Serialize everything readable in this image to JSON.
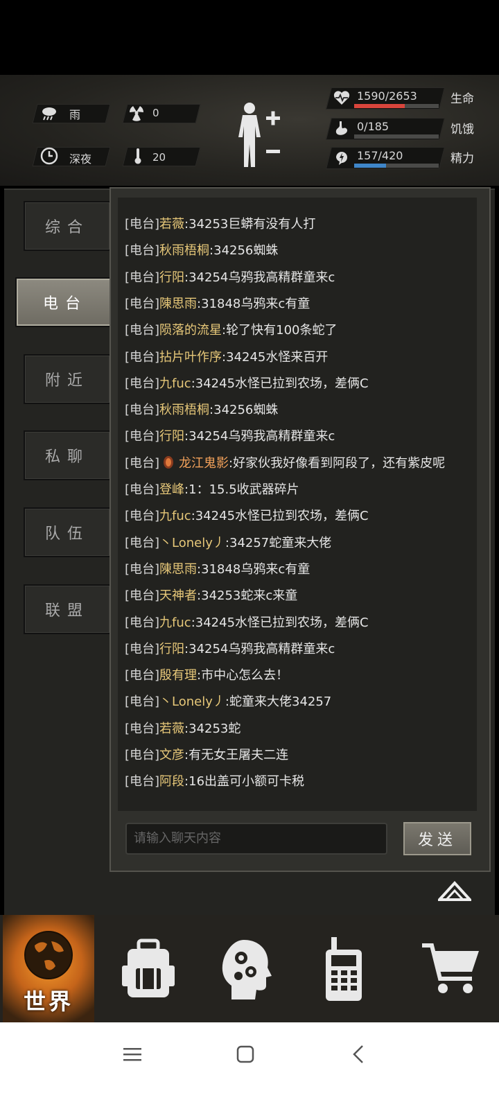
{
  "status": {
    "weather": {
      "icon": "rain-cloud-icon",
      "label": "雨"
    },
    "radiation": {
      "icon": "radiation-icon",
      "value": "0"
    },
    "time": {
      "icon": "clock-icon",
      "label": "深夜"
    },
    "temperature": {
      "icon": "thermometer-icon",
      "value": "20"
    },
    "body": {
      "icon": "body-figure-icon"
    },
    "health": {
      "value": "1590/2653",
      "label": "生命",
      "fraction": 0.599,
      "color": "#d9453c"
    },
    "hunger": {
      "value": "0/185",
      "label": "饥饿",
      "fraction": 0.0,
      "color": "#c9a24a"
    },
    "energy": {
      "value": "157/420",
      "label": "精力",
      "fraction": 0.374,
      "color": "#3f86c9"
    }
  },
  "tabs": [
    {
      "label": "综合",
      "active": false
    },
    {
      "label": "电台",
      "active": true
    },
    {
      "label": "附近",
      "active": false
    },
    {
      "label": "私聊",
      "active": false
    },
    {
      "label": "队伍",
      "active": false
    },
    {
      "label": "联盟",
      "active": false
    }
  ],
  "chat": {
    "messages": [
      {
        "tag": "[电台]",
        "name": "若薇",
        "text": ":34253巨蟒有没有人打"
      },
      {
        "tag": "[电台]",
        "name": "秋雨梧桐",
        "text": ":34256蜘蛛"
      },
      {
        "tag": "[电台]",
        "name": "行阳",
        "text": ":34254乌鸦我高精群童来c"
      },
      {
        "tag": "[电台]",
        "name": "陳思雨",
        "text": ":31848乌鸦来c有童"
      },
      {
        "tag": "[电台]",
        "name": "陨落的流星",
        "text": ":轮了快有100条蛇了"
      },
      {
        "tag": "[电台]",
        "name": "拈片叶作序",
        "text": ":34245水怪来百开"
      },
      {
        "tag": "[电台]",
        "name": "九fuc",
        "text": ":34245水怪已拉到农场，差俩C"
      },
      {
        "tag": "[电台]",
        "name": "秋雨梧桐",
        "text": ":34256蜘蛛"
      },
      {
        "tag": "[电台]",
        "name": "行阳",
        "text": ":34254乌鸦我高精群童来c"
      },
      {
        "tag": "[电台]",
        "name": "龙江鬼影",
        "text": ":好家伙我好像看到阿段了，还有紫皮呢",
        "badge": true
      },
      {
        "tag": "[电台]",
        "name": "登峰",
        "text": ":1：15.5收武器碎片"
      },
      {
        "tag": "[电台]",
        "name": "九fuc",
        "text": ":34245水怪已拉到农场，差俩C"
      },
      {
        "tag": "[电台]",
        "name": "丶Lonely丿",
        "text": ":34257蛇童来大佬"
      },
      {
        "tag": "[电台]",
        "name": "陳思雨",
        "text": ":31848乌鸦来c有童"
      },
      {
        "tag": "[电台]",
        "name": "天神者",
        "text": ":34253蛇来c来童"
      },
      {
        "tag": "[电台]",
        "name": "九fuc",
        "text": ":34245水怪已拉到农场，差俩C"
      },
      {
        "tag": "[电台]",
        "name": "行阳",
        "text": ":34254乌鸦我高精群童来c"
      },
      {
        "tag": "[电台]",
        "name": "殷有理",
        "text": ":市中心怎么去！"
      },
      {
        "tag": "[电台]",
        "name": "丶Lonely丿",
        "text": ":蛇童来大佬34257"
      },
      {
        "tag": "[电台]",
        "name": "若薇",
        "text": ":34253蛇"
      },
      {
        "tag": "[电台]",
        "name": "文彦",
        "text": ":有无女王屠夫二连"
      },
      {
        "tag": "[电台]",
        "name": "阿段",
        "text": ":16出盖可小额可卡税"
      }
    ],
    "input_placeholder": "请输入聊天内容",
    "send_label": "发送"
  },
  "bottom_nav": [
    {
      "icon": "globe-icon",
      "label": "世界",
      "active": true
    },
    {
      "icon": "backpack-icon",
      "label": ""
    },
    {
      "icon": "brain-gears-icon",
      "label": ""
    },
    {
      "icon": "walkie-talkie-icon",
      "label": ""
    },
    {
      "icon": "cart-icon",
      "label": ""
    }
  ],
  "system_nav": {
    "menu": "menu-icon",
    "home": "home-icon",
    "back": "back-icon"
  }
}
